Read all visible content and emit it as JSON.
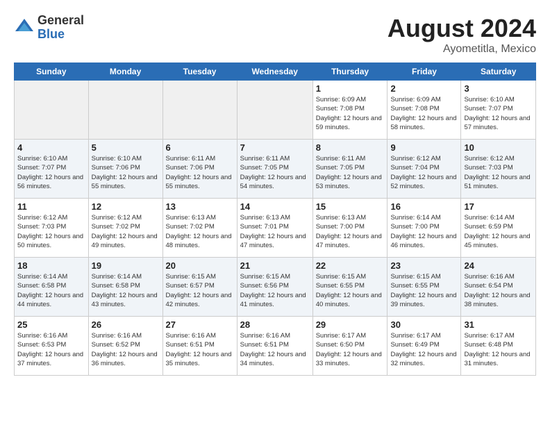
{
  "header": {
    "logo_general": "General",
    "logo_blue": "Blue",
    "title": "August 2024",
    "location": "Ayometitla, Mexico"
  },
  "days_of_week": [
    "Sunday",
    "Monday",
    "Tuesday",
    "Wednesday",
    "Thursday",
    "Friday",
    "Saturday"
  ],
  "weeks": [
    [
      {
        "day": "",
        "sunrise": "",
        "sunset": "",
        "daylight": ""
      },
      {
        "day": "",
        "sunrise": "",
        "sunset": "",
        "daylight": ""
      },
      {
        "day": "",
        "sunrise": "",
        "sunset": "",
        "daylight": ""
      },
      {
        "day": "",
        "sunrise": "",
        "sunset": "",
        "daylight": ""
      },
      {
        "day": "1",
        "sunrise": "Sunrise: 6:09 AM",
        "sunset": "Sunset: 7:08 PM",
        "daylight": "Daylight: 12 hours and 59 minutes."
      },
      {
        "day": "2",
        "sunrise": "Sunrise: 6:09 AM",
        "sunset": "Sunset: 7:08 PM",
        "daylight": "Daylight: 12 hours and 58 minutes."
      },
      {
        "day": "3",
        "sunrise": "Sunrise: 6:10 AM",
        "sunset": "Sunset: 7:07 PM",
        "daylight": "Daylight: 12 hours and 57 minutes."
      }
    ],
    [
      {
        "day": "4",
        "sunrise": "Sunrise: 6:10 AM",
        "sunset": "Sunset: 7:07 PM",
        "daylight": "Daylight: 12 hours and 56 minutes."
      },
      {
        "day": "5",
        "sunrise": "Sunrise: 6:10 AM",
        "sunset": "Sunset: 7:06 PM",
        "daylight": "Daylight: 12 hours and 55 minutes."
      },
      {
        "day": "6",
        "sunrise": "Sunrise: 6:11 AM",
        "sunset": "Sunset: 7:06 PM",
        "daylight": "Daylight: 12 hours and 55 minutes."
      },
      {
        "day": "7",
        "sunrise": "Sunrise: 6:11 AM",
        "sunset": "Sunset: 7:05 PM",
        "daylight": "Daylight: 12 hours and 54 minutes."
      },
      {
        "day": "8",
        "sunrise": "Sunrise: 6:11 AM",
        "sunset": "Sunset: 7:05 PM",
        "daylight": "Daylight: 12 hours and 53 minutes."
      },
      {
        "day": "9",
        "sunrise": "Sunrise: 6:12 AM",
        "sunset": "Sunset: 7:04 PM",
        "daylight": "Daylight: 12 hours and 52 minutes."
      },
      {
        "day": "10",
        "sunrise": "Sunrise: 6:12 AM",
        "sunset": "Sunset: 7:03 PM",
        "daylight": "Daylight: 12 hours and 51 minutes."
      }
    ],
    [
      {
        "day": "11",
        "sunrise": "Sunrise: 6:12 AM",
        "sunset": "Sunset: 7:03 PM",
        "daylight": "Daylight: 12 hours and 50 minutes."
      },
      {
        "day": "12",
        "sunrise": "Sunrise: 6:12 AM",
        "sunset": "Sunset: 7:02 PM",
        "daylight": "Daylight: 12 hours and 49 minutes."
      },
      {
        "day": "13",
        "sunrise": "Sunrise: 6:13 AM",
        "sunset": "Sunset: 7:02 PM",
        "daylight": "Daylight: 12 hours and 48 minutes."
      },
      {
        "day": "14",
        "sunrise": "Sunrise: 6:13 AM",
        "sunset": "Sunset: 7:01 PM",
        "daylight": "Daylight: 12 hours and 47 minutes."
      },
      {
        "day": "15",
        "sunrise": "Sunrise: 6:13 AM",
        "sunset": "Sunset: 7:00 PM",
        "daylight": "Daylight: 12 hours and 47 minutes."
      },
      {
        "day": "16",
        "sunrise": "Sunrise: 6:14 AM",
        "sunset": "Sunset: 7:00 PM",
        "daylight": "Daylight: 12 hours and 46 minutes."
      },
      {
        "day": "17",
        "sunrise": "Sunrise: 6:14 AM",
        "sunset": "Sunset: 6:59 PM",
        "daylight": "Daylight: 12 hours and 45 minutes."
      }
    ],
    [
      {
        "day": "18",
        "sunrise": "Sunrise: 6:14 AM",
        "sunset": "Sunset: 6:58 PM",
        "daylight": "Daylight: 12 hours and 44 minutes."
      },
      {
        "day": "19",
        "sunrise": "Sunrise: 6:14 AM",
        "sunset": "Sunset: 6:58 PM",
        "daylight": "Daylight: 12 hours and 43 minutes."
      },
      {
        "day": "20",
        "sunrise": "Sunrise: 6:15 AM",
        "sunset": "Sunset: 6:57 PM",
        "daylight": "Daylight: 12 hours and 42 minutes."
      },
      {
        "day": "21",
        "sunrise": "Sunrise: 6:15 AM",
        "sunset": "Sunset: 6:56 PM",
        "daylight": "Daylight: 12 hours and 41 minutes."
      },
      {
        "day": "22",
        "sunrise": "Sunrise: 6:15 AM",
        "sunset": "Sunset: 6:55 PM",
        "daylight": "Daylight: 12 hours and 40 minutes."
      },
      {
        "day": "23",
        "sunrise": "Sunrise: 6:15 AM",
        "sunset": "Sunset: 6:55 PM",
        "daylight": "Daylight: 12 hours and 39 minutes."
      },
      {
        "day": "24",
        "sunrise": "Sunrise: 6:16 AM",
        "sunset": "Sunset: 6:54 PM",
        "daylight": "Daylight: 12 hours and 38 minutes."
      }
    ],
    [
      {
        "day": "25",
        "sunrise": "Sunrise: 6:16 AM",
        "sunset": "Sunset: 6:53 PM",
        "daylight": "Daylight: 12 hours and 37 minutes."
      },
      {
        "day": "26",
        "sunrise": "Sunrise: 6:16 AM",
        "sunset": "Sunset: 6:52 PM",
        "daylight": "Daylight: 12 hours and 36 minutes."
      },
      {
        "day": "27",
        "sunrise": "Sunrise: 6:16 AM",
        "sunset": "Sunset: 6:51 PM",
        "daylight": "Daylight: 12 hours and 35 minutes."
      },
      {
        "day": "28",
        "sunrise": "Sunrise: 6:16 AM",
        "sunset": "Sunset: 6:51 PM",
        "daylight": "Daylight: 12 hours and 34 minutes."
      },
      {
        "day": "29",
        "sunrise": "Sunrise: 6:17 AM",
        "sunset": "Sunset: 6:50 PM",
        "daylight": "Daylight: 12 hours and 33 minutes."
      },
      {
        "day": "30",
        "sunrise": "Sunrise: 6:17 AM",
        "sunset": "Sunset: 6:49 PM",
        "daylight": "Daylight: 12 hours and 32 minutes."
      },
      {
        "day": "31",
        "sunrise": "Sunrise: 6:17 AM",
        "sunset": "Sunset: 6:48 PM",
        "daylight": "Daylight: 12 hours and 31 minutes."
      }
    ]
  ]
}
